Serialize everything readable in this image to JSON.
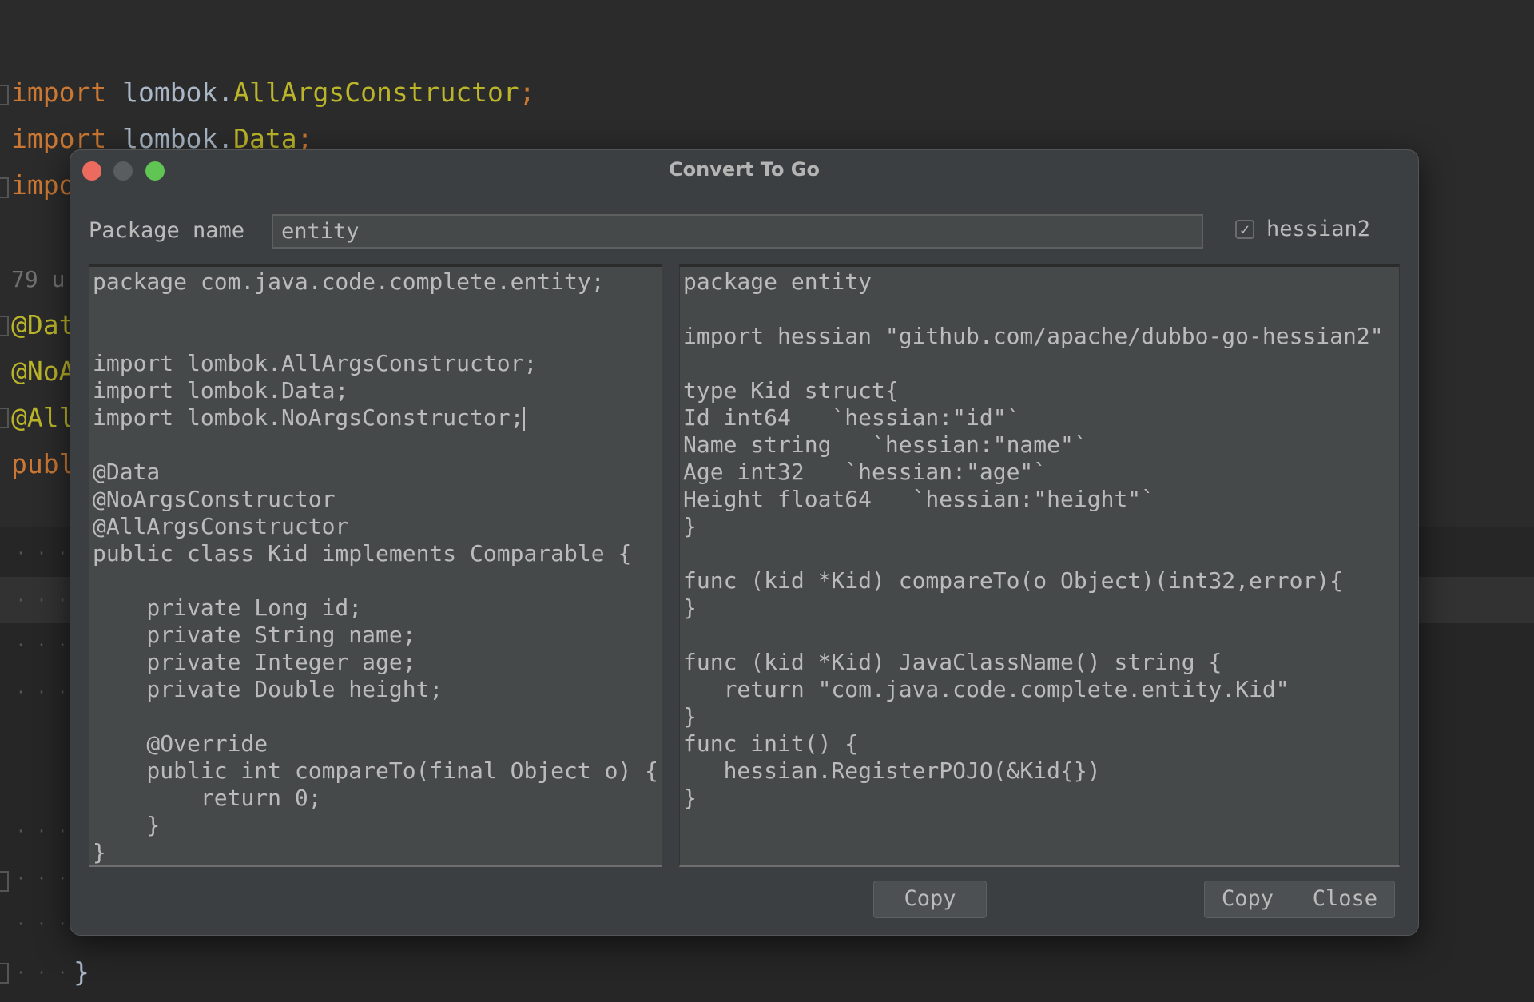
{
  "editor": {
    "lines": [
      {
        "kw": "import",
        "id": " lombok.",
        "cls": "AllArgsConstructor",
        "end": ";"
      },
      {
        "kw": "import",
        "id": " lombok.",
        "cls": "Data",
        "end": ";"
      },
      {
        "kw": "impo",
        "id": "",
        "cls": "",
        "end": ""
      }
    ],
    "usages": "79 u",
    "annotations": [
      "@Dat",
      "@NoA",
      "@All"
    ],
    "public_fragment": "publ",
    "closing_brace": "}"
  },
  "dialog": {
    "title": "Convert To Go",
    "package_label": "Package name",
    "package_value": "entity",
    "hessian_checkbox": {
      "label": "hessian2",
      "checked": true
    },
    "java_code": [
      "package com.java.code.complete.entity;",
      "",
      "",
      "import lombok.AllArgsConstructor;",
      "import lombok.Data;",
      "import lombok.NoArgsConstructor;",
      "",
      "@Data",
      "@NoArgsConstructor",
      "@AllArgsConstructor",
      "public class Kid implements Comparable {",
      "",
      "    private Long id;",
      "    private String name;",
      "    private Integer age;",
      "    private Double height;",
      "",
      "    @Override",
      "    public int compareTo(final Object o) {",
      "        return 0;",
      "    }",
      "}"
    ],
    "go_code": [
      "package entity",
      "",
      "import hessian \"github.com/apache/dubbo-go-hessian2\"",
      "",
      "type Kid struct{",
      "Id int64   `hessian:\"id\"`",
      "Name string   `hessian:\"name\"`",
      "Age int32   `hessian:\"age\"`",
      "Height float64   `hessian:\"height\"`",
      "}",
      "",
      "func (kid *Kid) compareTo(o Object)(int32,error){",
      "}",
      "",
      "func (kid *Kid) JavaClassName() string {",
      "   return \"com.java.code.complete.entity.Kid\"",
      "}",
      "func init() {",
      "   hessian.RegisterPOJO(&Kid{})",
      "}"
    ],
    "copy_button": "Copy",
    "copy_close_button": "Copy   Close",
    "colors": {
      "close": "#ed6a5e",
      "minimize": "#5a5d5f",
      "zoom": "#61c554"
    }
  }
}
